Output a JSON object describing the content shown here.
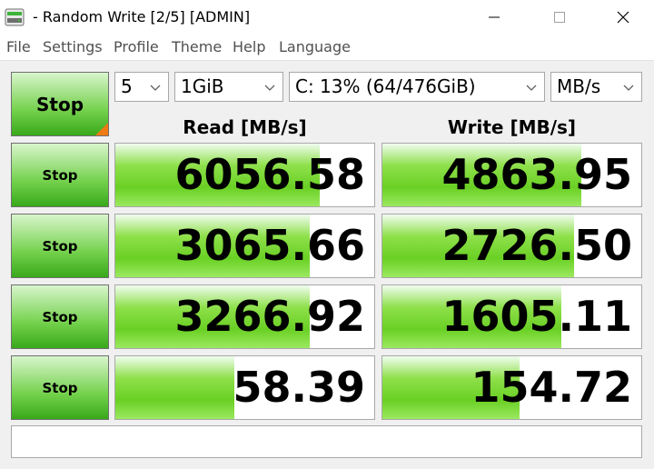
{
  "window": {
    "title": "- Random Write [2/5] [ADMIN]"
  },
  "menu": {
    "items": [
      "File",
      "Settings",
      "Profile",
      "Theme",
      "Help",
      "Language"
    ]
  },
  "controls": {
    "main_button": "Stop",
    "count": "5",
    "size": "1GiB",
    "drive": "C: 13% (64/476GiB)",
    "unit": "MB/s"
  },
  "headers": {
    "read": "Read [MB/s]",
    "write": "Write [MB/s]"
  },
  "rows": [
    {
      "button": "Stop",
      "read": "6056.58",
      "write": "4863.95",
      "read_fill": 0.79,
      "write_fill": 0.77
    },
    {
      "button": "Stop",
      "read": "3065.66",
      "write": "2726.50",
      "read_fill": 0.75,
      "write_fill": 0.74
    },
    {
      "button": "Stop",
      "read": "3266.92",
      "write": "1605.11",
      "read_fill": 0.75,
      "write_fill": 0.69
    },
    {
      "button": "Stop",
      "read": "58.39",
      "write": "154.72",
      "read_fill": 0.46,
      "write_fill": 0.53
    }
  ],
  "status": {
    "text": ""
  }
}
